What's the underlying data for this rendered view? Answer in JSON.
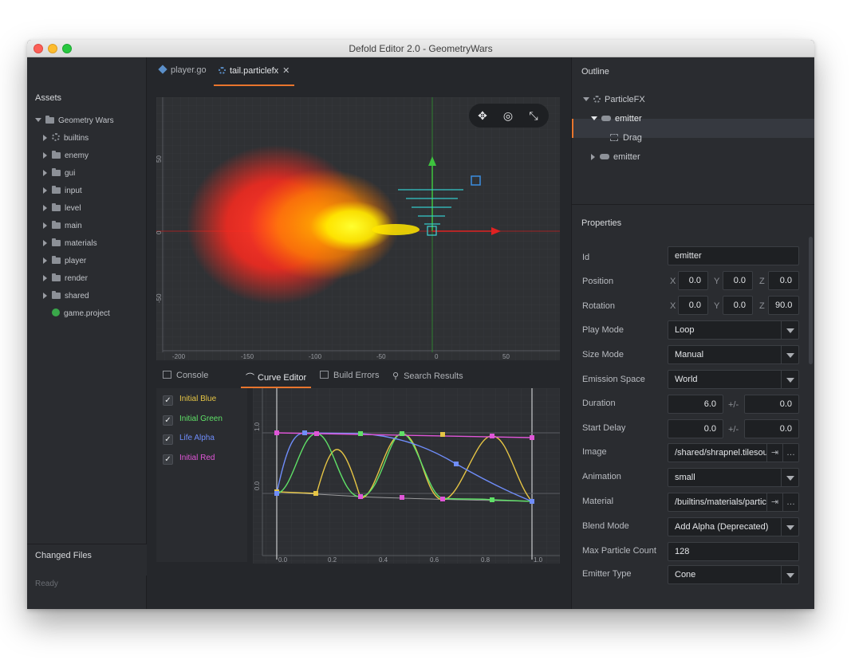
{
  "window": {
    "title": "Defold Editor 2.0 - GeometryWars"
  },
  "assets": {
    "title": "Assets",
    "root": "Geometry Wars",
    "items": [
      {
        "label": "builtins",
        "icon": "gear-icon"
      },
      {
        "label": "enemy",
        "icon": "folder-icon"
      },
      {
        "label": "gui",
        "icon": "folder-icon"
      },
      {
        "label": "input",
        "icon": "folder-icon"
      },
      {
        "label": "level",
        "icon": "folder-icon"
      },
      {
        "label": "main",
        "icon": "folder-icon"
      },
      {
        "label": "materials",
        "icon": "folder-icon"
      },
      {
        "label": "player",
        "icon": "folder-icon"
      },
      {
        "label": "render",
        "icon": "folder-icon"
      },
      {
        "label": "shared",
        "icon": "folder-icon"
      }
    ],
    "file": "game.project",
    "changed_files": "Changed Files",
    "status": "Ready"
  },
  "tabs": [
    {
      "label": "player.go"
    },
    {
      "label": "tail.particlefx",
      "close": "✕"
    }
  ],
  "scene": {
    "x_ticks": [
      "-200",
      "-150",
      "-100",
      "-50",
      "0",
      "50"
    ],
    "y_ticks": [
      "50",
      "0",
      "-50"
    ],
    "tools": [
      "move-tool",
      "rotate-tool",
      "scale-tool"
    ]
  },
  "bottom_tabs": [
    {
      "label": "Console"
    },
    {
      "label": "Curve Editor"
    },
    {
      "label": "Build Errors"
    },
    {
      "label": "Search Results"
    }
  ],
  "curves": [
    {
      "label": "Initial Blue",
      "color": "#e6c545",
      "checked": true
    },
    {
      "label": "Initial Green",
      "color": "#5fe067",
      "checked": true
    },
    {
      "label": "Life Alpha",
      "color": "#6f8dfa",
      "checked": true
    },
    {
      "label": "Initial Red",
      "color": "#e056d8",
      "checked": true
    }
  ],
  "curve_graph": {
    "y_ticks": [
      "1.0",
      "0.0"
    ],
    "x_ticks": [
      "0.0",
      "0.2",
      "0.4",
      "0.6",
      "0.8",
      "1.0"
    ]
  },
  "outline": {
    "title": "Outline",
    "root": "ParticleFX",
    "emitter1": "emitter",
    "modifier": "Drag",
    "emitter2": "emitter"
  },
  "properties": {
    "title": "Properties",
    "id": {
      "label": "Id",
      "value": "emitter"
    },
    "position": {
      "label": "Position",
      "x": "0.0",
      "y": "0.0",
      "z": "0.0"
    },
    "rotation": {
      "label": "Rotation",
      "x": "0.0",
      "y": "0.0",
      "z": "90.0"
    },
    "play_mode": {
      "label": "Play Mode",
      "value": "Loop"
    },
    "size_mode": {
      "label": "Size Mode",
      "value": "Manual"
    },
    "emission_space": {
      "label": "Emission Space",
      "value": "World"
    },
    "duration": {
      "label": "Duration",
      "value": "6.0",
      "spread": "0.0"
    },
    "start_delay": {
      "label": "Start Delay",
      "value": "0.0",
      "spread": "0.0"
    },
    "image": {
      "label": "Image",
      "value": "/shared/shrapnel.tilesource"
    },
    "animation": {
      "label": "Animation",
      "value": "small"
    },
    "material": {
      "label": "Material",
      "value": "/builtins/materials/particlefx.material"
    },
    "blend_mode": {
      "label": "Blend Mode",
      "value": "Add Alpha (Deprecated)"
    },
    "max_particle_count": {
      "label": "Max Particle Count",
      "value": "128"
    },
    "emitter_type": {
      "label": "Emitter Type",
      "value": "Cone"
    },
    "axis_x": "X",
    "axis_y": "Y",
    "axis_z": "Z",
    "plusminus": "+/-"
  }
}
